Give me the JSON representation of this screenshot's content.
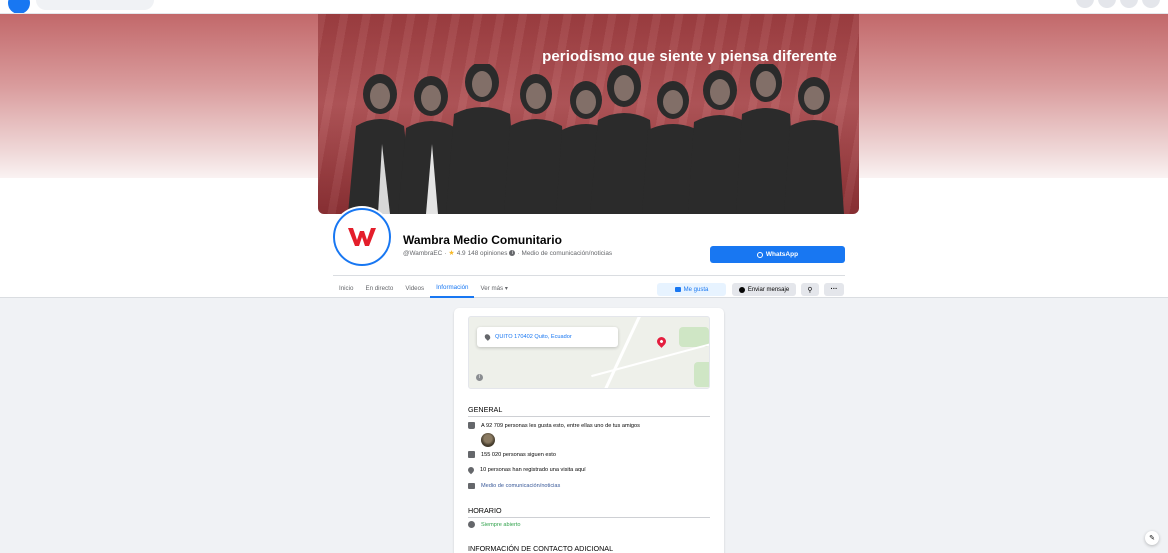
{
  "page": {
    "cover_tagline": "periodismo que siente y piensa diferente",
    "name": "Wambra Medio Comunitario",
    "handle": "@WambraEC",
    "rating": "4.9",
    "reviews": "148 opiniones",
    "category": "Medio de comunicación/noticias",
    "avatar_letter": "w"
  },
  "actions": {
    "whatsapp": "WhatsApp",
    "like": "Me gusta",
    "message": "Enviar mensaje"
  },
  "tabs": [
    "Inicio",
    "En directo",
    "Videos",
    "Información",
    "Ver más"
  ],
  "active_tab_index": 3,
  "info": {
    "address": "QUITO 170402 Quito, Ecuador",
    "general_title": "GENERAL",
    "likes_text": "A 92 709 personas les gusta esto, entre ellas uno de tus amigos",
    "followers_text": "155 020 personas siguen esto",
    "checkins_text": "10 personas han registrado una visita aquí",
    "category_link": "Medio de comunicación/noticias",
    "hours_title": "HORARIO",
    "hours_text": "Siempre abierto",
    "contact_title": "INFORMACIÓN DE CONTACTO ADICIONAL"
  },
  "colors": {
    "accent": "#1877f2",
    "brand_red": "#e41e2b",
    "cover_red": "#b15558",
    "open_green": "#31a24c"
  },
  "icons": [
    "facebook-logo-icon",
    "whatsapp-icon",
    "thumbs-up-icon",
    "messenger-icon",
    "search-icon",
    "more-icon",
    "location-pin-icon",
    "info-icon",
    "followers-icon",
    "folder-icon",
    "clock-icon",
    "edit-icon"
  ]
}
